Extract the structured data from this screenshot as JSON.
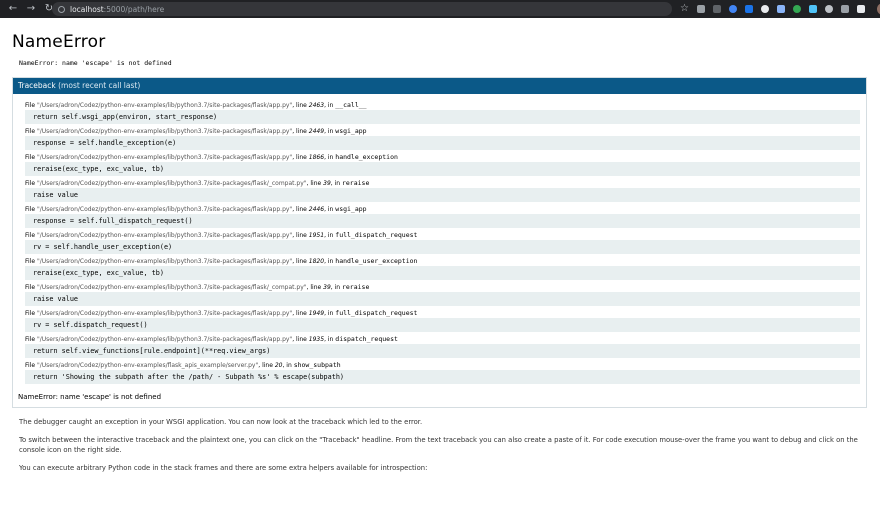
{
  "browser": {
    "url_host": "localhost",
    "url_path": ":5000/path/here"
  },
  "page": {
    "title": "NameError",
    "error_message": "NameError: name 'escape' is not defined"
  },
  "traceback": {
    "header_title": "Traceback",
    "header_sub": "(most recent call last)",
    "frames": [
      {
        "path": "\"/Users/adron/Codez/python-env-examples/lib/python3.7/site-packages/flask/app.py\"",
        "line": "2463",
        "func": "__call__",
        "code": "return self.wsgi_app(environ, start_response)"
      },
      {
        "path": "\"/Users/adron/Codez/python-env-examples/lib/python3.7/site-packages/flask/app.py\"",
        "line": "2449",
        "func": "wsgi_app",
        "code": "response = self.handle_exception(e)"
      },
      {
        "path": "\"/Users/adron/Codez/python-env-examples/lib/python3.7/site-packages/flask/app.py\"",
        "line": "1866",
        "func": "handle_exception",
        "code": "reraise(exc_type, exc_value, tb)"
      },
      {
        "path": "\"/Users/adron/Codez/python-env-examples/lib/python3.7/site-packages/flask/_compat.py\"",
        "line": "39",
        "func": "reraise",
        "code": "raise value"
      },
      {
        "path": "\"/Users/adron/Codez/python-env-examples/lib/python3.7/site-packages/flask/app.py\"",
        "line": "2446",
        "func": "wsgi_app",
        "code": "response = self.full_dispatch_request()"
      },
      {
        "path": "\"/Users/adron/Codez/python-env-examples/lib/python3.7/site-packages/flask/app.py\"",
        "line": "1951",
        "func": "full_dispatch_request",
        "code": "rv = self.handle_user_exception(e)"
      },
      {
        "path": "\"/Users/adron/Codez/python-env-examples/lib/python3.7/site-packages/flask/app.py\"",
        "line": "1820",
        "func": "handle_user_exception",
        "code": "reraise(exc_type, exc_value, tb)"
      },
      {
        "path": "\"/Users/adron/Codez/python-env-examples/lib/python3.7/site-packages/flask/_compat.py\"",
        "line": "39",
        "func": "reraise",
        "code": "raise value"
      },
      {
        "path": "\"/Users/adron/Codez/python-env-examples/lib/python3.7/site-packages/flask/app.py\"",
        "line": "1949",
        "func": "full_dispatch_request",
        "code": "rv = self.dispatch_request()"
      },
      {
        "path": "\"/Users/adron/Codez/python-env-examples/lib/python3.7/site-packages/flask/app.py\"",
        "line": "1935",
        "func": "dispatch_request",
        "code": "return self.view_functions[rule.endpoint](**req.view_args)"
      },
      {
        "path": "\"/Users/adron/Codez/python-env-examples/flask_apis_example/server.py\"",
        "line": "20",
        "func": "show_subpath",
        "code": "return 'Showing the subpath after the /path/ - Subpath %s' % escape(subpath)"
      }
    ],
    "file_label": "File",
    "line_label": ", line",
    "in_label": ", in",
    "final_error": "NameError: name 'escape' is not defined"
  },
  "explanation": {
    "p1": "The debugger caught an exception in your WSGI application. You can now look at the traceback which led to the error.",
    "p2": "To switch between the interactive traceback and the plaintext one, you can click on the \"Traceback\" headline. From the text traceback you can also create a paste of it. For code execution mouse-over the frame you want to debug and click on the console icon on the right side.",
    "p3": "You can execute arbitrary Python code in the stack frames and there are some extra helpers available for introspection:"
  },
  "colors": {
    "header_bg": "#0b5988",
    "code_bg": "#e8eff0"
  }
}
